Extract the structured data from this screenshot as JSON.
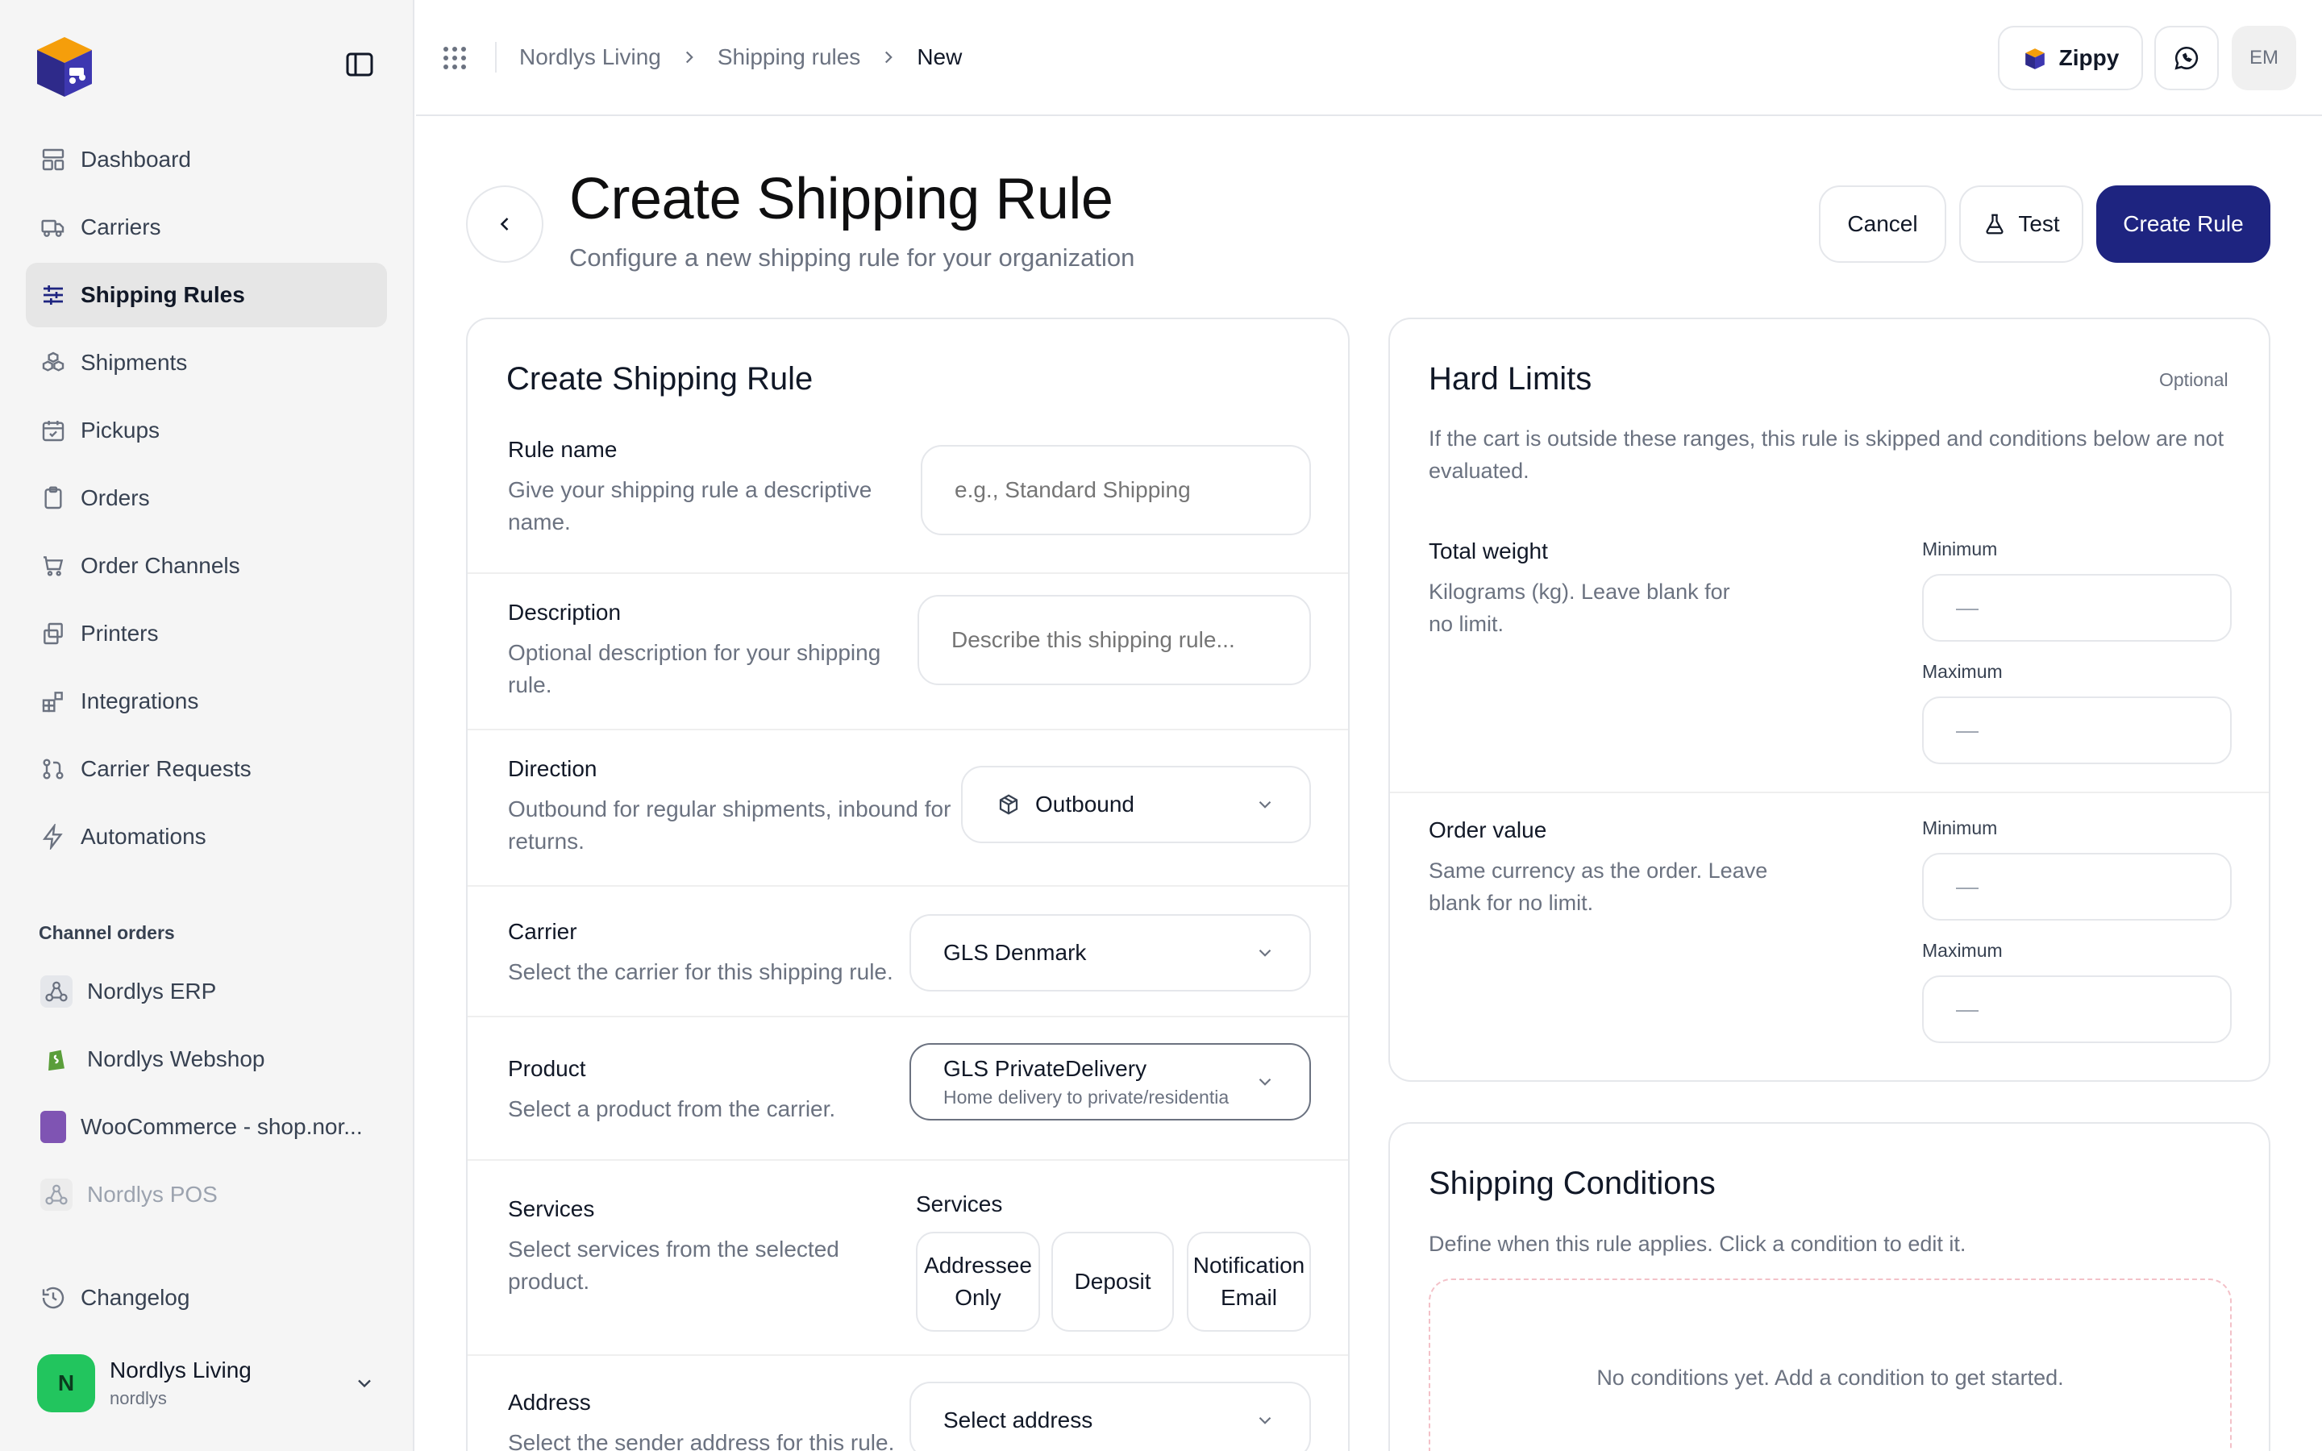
{
  "sidebar": {
    "nav": [
      {
        "label": "Dashboard",
        "icon": "dashboard-icon"
      },
      {
        "label": "Carriers",
        "icon": "truck-icon"
      },
      {
        "label": "Shipping Rules",
        "icon": "sliders-icon",
        "active": true
      },
      {
        "label": "Shipments",
        "icon": "boxes-icon"
      },
      {
        "label": "Pickups",
        "icon": "calendar-check-icon"
      },
      {
        "label": "Orders",
        "icon": "clipboard-icon"
      },
      {
        "label": "Order Channels",
        "icon": "cart-icon"
      },
      {
        "label": "Printers",
        "icon": "printer-icon"
      },
      {
        "label": "Integrations",
        "icon": "blocks-icon"
      },
      {
        "label": "Carrier Requests",
        "icon": "git-pull-icon"
      },
      {
        "label": "Automations",
        "icon": "zap-icon"
      }
    ],
    "section_title": "Channel orders",
    "channels": [
      {
        "label": "Nordlys ERP",
        "icon": "webhook-icon"
      },
      {
        "label": "Nordlys Webshop",
        "icon": "shopify-icon"
      },
      {
        "label": "WooCommerce - shop.nor...",
        "icon": "woocommerce-icon"
      },
      {
        "label": "Nordlys POS",
        "icon": "webhook-icon",
        "muted": true
      }
    ],
    "changelog": "Changelog",
    "org": {
      "initial": "N",
      "name": "Nordlys Living",
      "slug": "nordlys"
    }
  },
  "topbar": {
    "breadcrumb": [
      "Nordlys Living",
      "Shipping rules",
      "New"
    ],
    "zippy_label": "Zippy",
    "avatar_initials": "EM"
  },
  "header": {
    "title": "Create Shipping Rule",
    "subtitle": "Configure a new shipping rule for your organization",
    "cancel": "Cancel",
    "test": "Test",
    "create": "Create Rule"
  },
  "form": {
    "title": "Create Shipping Rule",
    "rule_name": {
      "label": "Rule name",
      "help": "Give your shipping rule a descriptive name.",
      "placeholder": "e.g., Standard Shipping"
    },
    "description": {
      "label": "Description",
      "help": "Optional description for your shipping rule.",
      "placeholder": "Describe this shipping rule..."
    },
    "direction": {
      "label": "Direction",
      "help": "Outbound for regular shipments, inbound for returns.",
      "value": "Outbound"
    },
    "carrier": {
      "label": "Carrier",
      "help": "Select the carrier for this shipping rule.",
      "value": "GLS Denmark"
    },
    "product": {
      "label": "Product",
      "help": "Select a product from the carrier.",
      "value": "GLS PrivateDelivery",
      "value_sub": "Home delivery to private/residentia"
    },
    "services": {
      "label": "Services",
      "help": "Select services from the selected product.",
      "group_title": "Services",
      "options": [
        "Addressee Only",
        "Deposit",
        "Notification Email"
      ]
    },
    "address": {
      "label": "Address",
      "help": "Select the sender address for this rule.",
      "value": "Select address"
    }
  },
  "limits": {
    "title": "Hard Limits",
    "optional": "Optional",
    "description": "If the cart is outside these ranges, this rule is skipped and conditions below are not evaluated.",
    "weight": {
      "label": "Total weight",
      "help": "Kilograms (kg). Leave blank for no limit.",
      "min_label": "Minimum",
      "max_label": "Maximum",
      "min_value": "—",
      "max_value": "—"
    },
    "order_value": {
      "label": "Order value",
      "help": "Same currency as the order. Leave blank for no limit.",
      "min_label": "Minimum",
      "max_label": "Maximum",
      "min_value": "—",
      "max_value": "—"
    }
  },
  "conditions": {
    "title": "Shipping Conditions",
    "description": "Define when this rule applies. Click a condition to edit it.",
    "empty": "No conditions yet. Add a condition to get started."
  },
  "colors": {
    "primary": "#1e2480",
    "org_avatar": "#22c55e",
    "active_nav": "#e6e6e6"
  }
}
